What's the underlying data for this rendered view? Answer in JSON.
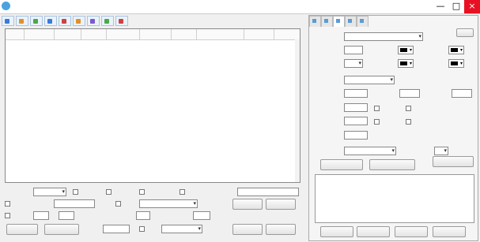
{
  "window": {
    "title": "",
    "buttons": [
      "—",
      "□",
      "×"
    ]
  },
  "toolbar": [
    {
      "label": "",
      "color": "#3a7bd5"
    },
    {
      "label": "",
      "color": "#e0902a"
    },
    {
      "label": "",
      "color": "#4aa84a"
    },
    {
      "label": "",
      "color": "#3a7bd5"
    },
    {
      "label": "",
      "color": "#d04040"
    },
    {
      "label": "",
      "color": "#e0902a"
    },
    {
      "label": "",
      "color": "#7a5ad0"
    },
    {
      "label": "",
      "color": "#4aa84a"
    },
    {
      "label": "",
      "color": "#d04040"
    }
  ],
  "table": {
    "columns": [
      "",
      "",
      "",
      "",
      "",
      "",
      "",
      "",
      "",
      ""
    ]
  },
  "bottom": {
    "op_mode_label": "",
    "op_mode_value": "",
    "lr_flip": "",
    "ud_flip": "",
    "watermark_link": "",
    "filter_link": "",
    "save_dir_label": "",
    "rotate_crop": "",
    "frame_range": "",
    "resolution_label": "",
    "resolution_value": "",
    "select_dir": "",
    "open_dir": "",
    "pull_frame": "",
    "frame_rate_label": "",
    "frame_rate_sep": "",
    "extract_label": "",
    "frame_label": "",
    "delete_head": "",
    "sec_unit": "",
    "delete_tail": "",
    "load_video": "",
    "clear_video": "",
    "bitrate_label": "",
    "bitrate_unit": "",
    "rotate_label": "",
    "rotate_value": "",
    "start": "",
    "stop": ""
  },
  "right_panel": {
    "tabs": [
      "",
      "",
      "",
      "",
      ""
    ],
    "help": "",
    "font_label": "",
    "font_value": "",
    "font_size_label": "",
    "font_size_value": "",
    "font_color_label": "",
    "stroke_label": "",
    "stroke_size_label": "",
    "stroke_size_value": "",
    "stroke_color_label": "",
    "shadow_color_label": "",
    "position_label": "",
    "position_value": "",
    "left_margin_label": "",
    "top_margin_label": "",
    "right_margin_label": "",
    "char_spacing_label": "",
    "bold": "",
    "italic": "",
    "line_spacing_label": "",
    "underline": "",
    "strikeout": "",
    "angle_label": "",
    "effect_label": "",
    "effect_value": "",
    "scroll_speed_label": "",
    "scroll_speed_value": "",
    "preview_btn": "",
    "save_preset_btn": "",
    "use_recommended_btn": "",
    "preset_group": "",
    "preset_columns": [
      "",
      ""
    ],
    "modify_btn": "",
    "delete_btn": "",
    "rename_btn": "",
    "clear_btn": ""
  }
}
